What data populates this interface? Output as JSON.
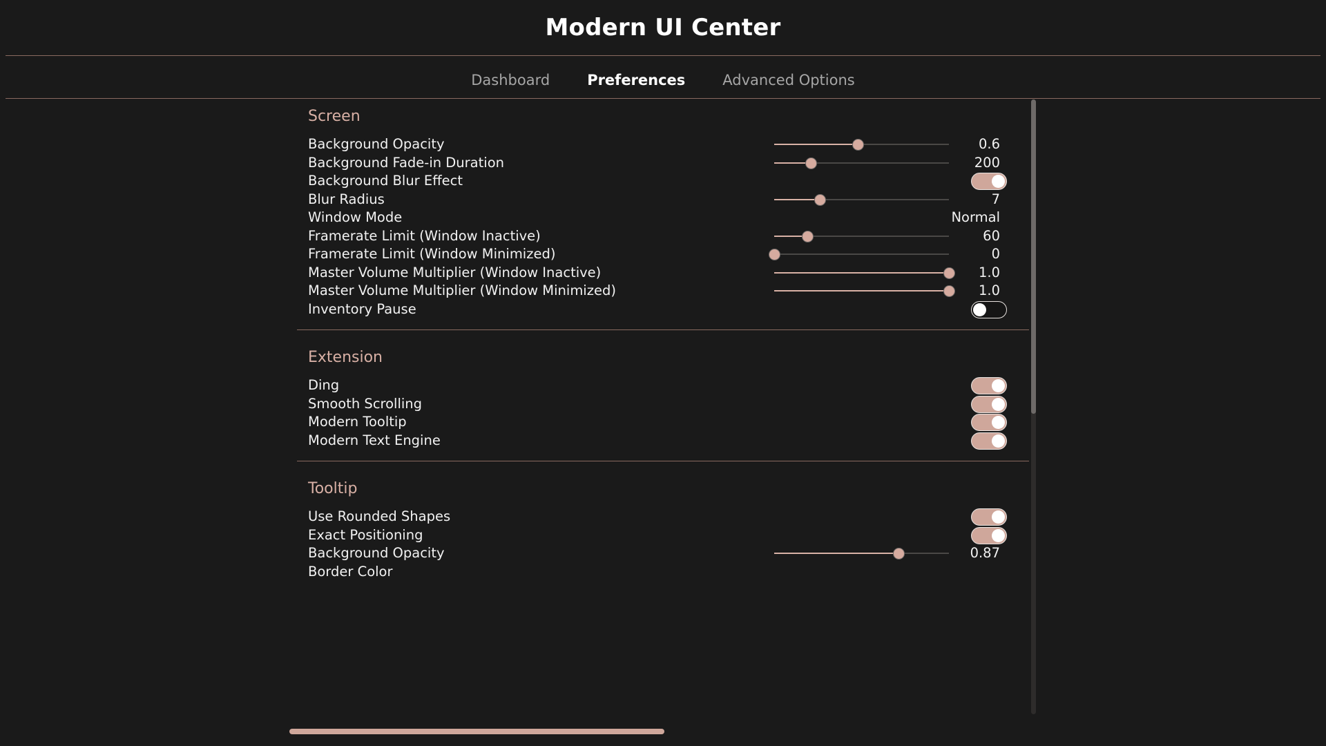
{
  "header": {
    "title": "Modern UI Center",
    "tabs": [
      {
        "label": "Dashboard",
        "active": false
      },
      {
        "label": "Preferences",
        "active": true
      },
      {
        "label": "Advanced Options",
        "active": false
      }
    ]
  },
  "colors": {
    "background": "#1a1a1a",
    "accent": "#d9b2a6",
    "section_title": "#d8b0a5",
    "rule": "#8a6a60",
    "text": "#f2f2f2",
    "tab_inactive": "#a6a6a6",
    "slider_track": "#4a4846",
    "knob": "#d6ab9f",
    "scrollbar_thumb": "#6e6a68"
  },
  "sections": [
    {
      "title": "Screen",
      "rows": [
        {
          "label": "Background Opacity",
          "control": "slider",
          "value": "0.6",
          "fill_pct": 48
        },
        {
          "label": "Background Fade-in Duration",
          "control": "slider",
          "value": "200",
          "fill_pct": 21
        },
        {
          "label": "Background Blur Effect",
          "control": "toggle",
          "value": "on"
        },
        {
          "label": "Blur Radius",
          "control": "slider",
          "value": "7",
          "fill_pct": 26
        },
        {
          "label": "Window Mode",
          "control": "text",
          "value": "Normal"
        },
        {
          "label": "Framerate Limit (Window Inactive)",
          "control": "slider",
          "value": "60",
          "fill_pct": 19
        },
        {
          "label": "Framerate Limit (Window Minimized)",
          "control": "slider",
          "value": "0",
          "fill_pct": 0
        },
        {
          "label": "Master Volume Multiplier (Window Inactive)",
          "control": "slider",
          "value": "1.0",
          "fill_pct": 100
        },
        {
          "label": "Master Volume Multiplier (Window Minimized)",
          "control": "slider",
          "value": "1.0",
          "fill_pct": 100
        },
        {
          "label": "Inventory Pause",
          "control": "toggle",
          "value": "off"
        }
      ]
    },
    {
      "title": "Extension",
      "rows": [
        {
          "label": "Ding",
          "control": "toggle",
          "value": "on"
        },
        {
          "label": "Smooth Scrolling",
          "control": "toggle",
          "value": "on"
        },
        {
          "label": "Modern Tooltip",
          "control": "toggle",
          "value": "on"
        },
        {
          "label": "Modern Text Engine",
          "control": "toggle",
          "value": "on"
        }
      ]
    },
    {
      "title": "Tooltip",
      "rows": [
        {
          "label": "Use Rounded Shapes",
          "control": "toggle",
          "value": "on"
        },
        {
          "label": "Exact Positioning",
          "control": "toggle",
          "value": "on"
        },
        {
          "label": "Background Opacity",
          "control": "slider",
          "value": "0.87",
          "fill_pct": 71
        },
        {
          "label": "Border Color",
          "control": "none",
          "value": ""
        }
      ]
    }
  ],
  "scrollbars": {
    "vertical": {
      "thumb_fraction": 0.51
    },
    "horizontal": {
      "thumb_fraction": 0.51
    }
  }
}
